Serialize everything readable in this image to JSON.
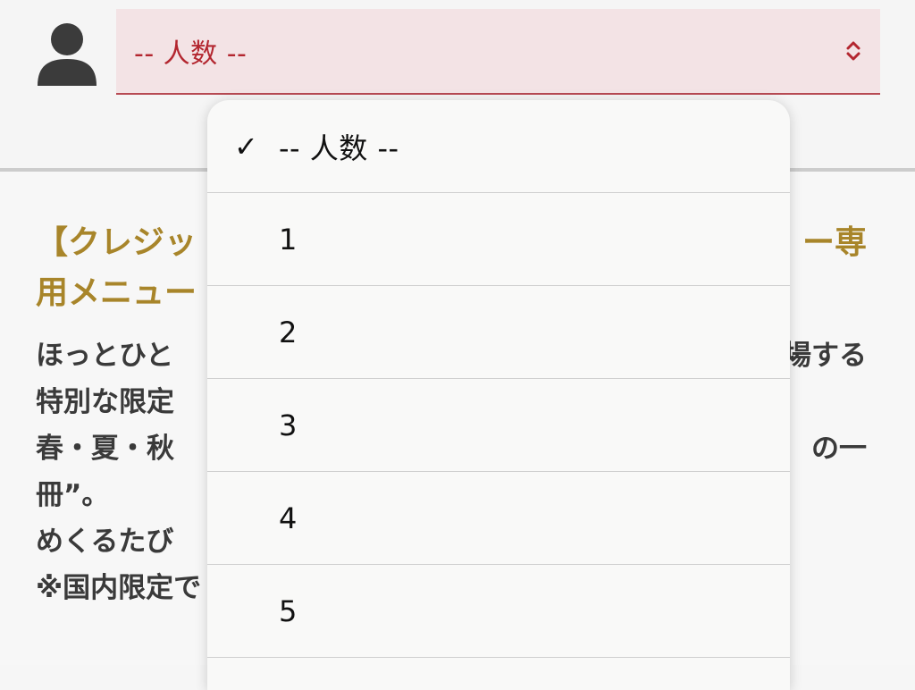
{
  "header": {
    "select_value": "-- 人数 --",
    "accent_color": "#b3262f",
    "select_bg": "#f3e3e5",
    "user_icon": "person-icon",
    "chevron_icon": "updown-chevron-icon"
  },
  "dropdown": {
    "options": [
      {
        "label": "-- 人数 --",
        "selected": true
      },
      {
        "label": "1",
        "selected": false
      },
      {
        "label": "2",
        "selected": false
      },
      {
        "label": "3",
        "selected": false
      },
      {
        "label": "4",
        "selected": false
      },
      {
        "label": "5",
        "selected": false
      }
    ],
    "check_mark": "✓"
  },
  "background": {
    "heading_line1_left": "【クレジッ",
    "heading_line1_right": "ー専",
    "heading_line2_left": "用メニュー",
    "para_line1_left": "ほっとひと",
    "para_line1_right": "場する",
    "para_line2_left": "特別な限定",
    "para_line3_left": "春・夏・秋",
    "para_line3_right": "の一",
    "para_line4_left": "冊”。",
    "para_line5_left": "めくるたび",
    "para_line6_left": "※国内限定で"
  }
}
